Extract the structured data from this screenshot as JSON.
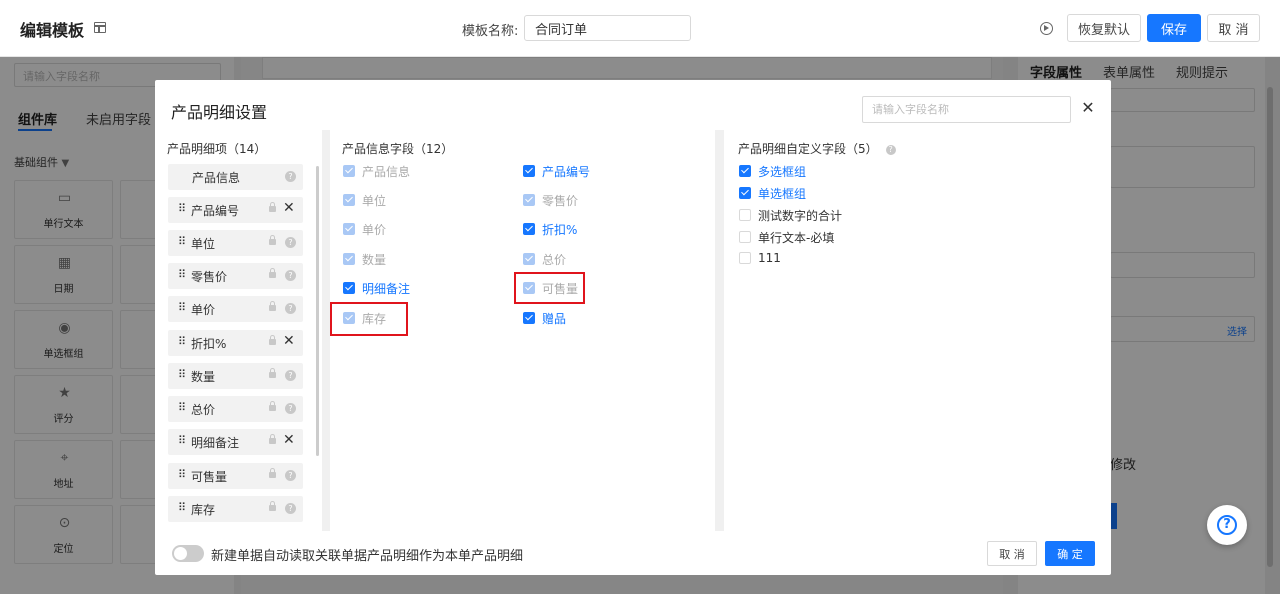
{
  "topbar": {
    "title": "编辑模板",
    "template_name_label": "模板名称:",
    "template_name_value": "合同订单",
    "restore_label": "恢复默认",
    "save_label": "保存",
    "cancel_label": "取 消"
  },
  "background": {
    "field_search_placeholder": "请输入字段名称",
    "tab_components": "组件库",
    "tab_unused": "未启用字段（",
    "group_basic": "基础组件",
    "tiles": [
      {
        "label": "单行文本",
        "icon": "text-field-icon"
      },
      {
        "label": "日期",
        "icon": "calendar-icon"
      },
      {
        "label": "单选框组",
        "icon": "radio-icon"
      },
      {
        "label": "评分",
        "icon": "star-icon"
      },
      {
        "label": "地址",
        "icon": "map-pin-icon"
      },
      {
        "label": "定位",
        "icon": "location-icon"
      }
    ],
    "right_tabs": [
      "字段属性",
      "表单属性",
      "规则提示"
    ],
    "select_link": "选择",
    "modify_text": "修改"
  },
  "modal": {
    "title": "产品明细设置",
    "search_placeholder": "请输入字段名称",
    "close": "✕",
    "col1": {
      "header": "产品明细项（14）",
      "items": [
        {
          "label": "产品信息",
          "draggable": false,
          "action": "help"
        },
        {
          "label": "产品编号",
          "draggable": true,
          "action": "remove"
        },
        {
          "label": "单位",
          "draggable": true,
          "action": "help"
        },
        {
          "label": "零售价",
          "draggable": true,
          "action": "help"
        },
        {
          "label": "单价",
          "draggable": true,
          "action": "help"
        },
        {
          "label": "折扣%",
          "draggable": true,
          "action": "remove"
        },
        {
          "label": "数量",
          "draggable": true,
          "action": "help"
        },
        {
          "label": "总价",
          "draggable": true,
          "action": "help"
        },
        {
          "label": "明细备注",
          "draggable": true,
          "action": "remove"
        },
        {
          "label": "可售量",
          "draggable": true,
          "action": "help"
        },
        {
          "label": "库存",
          "draggable": true,
          "action": "help"
        }
      ]
    },
    "col2": {
      "header": "产品信息字段（12）",
      "left": [
        {
          "label": "产品信息",
          "state": "disabled"
        },
        {
          "label": "单位",
          "state": "disabled"
        },
        {
          "label": "单价",
          "state": "disabled"
        },
        {
          "label": "数量",
          "state": "disabled"
        },
        {
          "label": "明细备注",
          "state": "checked"
        },
        {
          "label": "库存",
          "state": "disabled"
        }
      ],
      "right": [
        {
          "label": "产品编号",
          "state": "checked"
        },
        {
          "label": "零售价",
          "state": "disabled"
        },
        {
          "label": "折扣%",
          "state": "checked"
        },
        {
          "label": "总价",
          "state": "disabled"
        },
        {
          "label": "可售量",
          "state": "disabled"
        },
        {
          "label": "赠品",
          "state": "checked"
        }
      ]
    },
    "col3": {
      "header": "产品明细自定义字段（5）",
      "items": [
        {
          "label": "多选框组",
          "state": "checked"
        },
        {
          "label": "单选框组",
          "state": "checked"
        },
        {
          "label": "测试数字的合计",
          "state": "unchecked"
        },
        {
          "label": "单行文本-必填",
          "state": "unchecked"
        },
        {
          "label": "111",
          "state": "unchecked"
        }
      ]
    },
    "footer": {
      "toggle_label": "新建单据自动读取关联单据产品明细作为本单产品明细",
      "toggle_on": false,
      "cancel_label": "取 消",
      "ok_label": "确 定"
    }
  },
  "colors": {
    "primary": "#1677ff",
    "highlight": "#e0141c"
  }
}
